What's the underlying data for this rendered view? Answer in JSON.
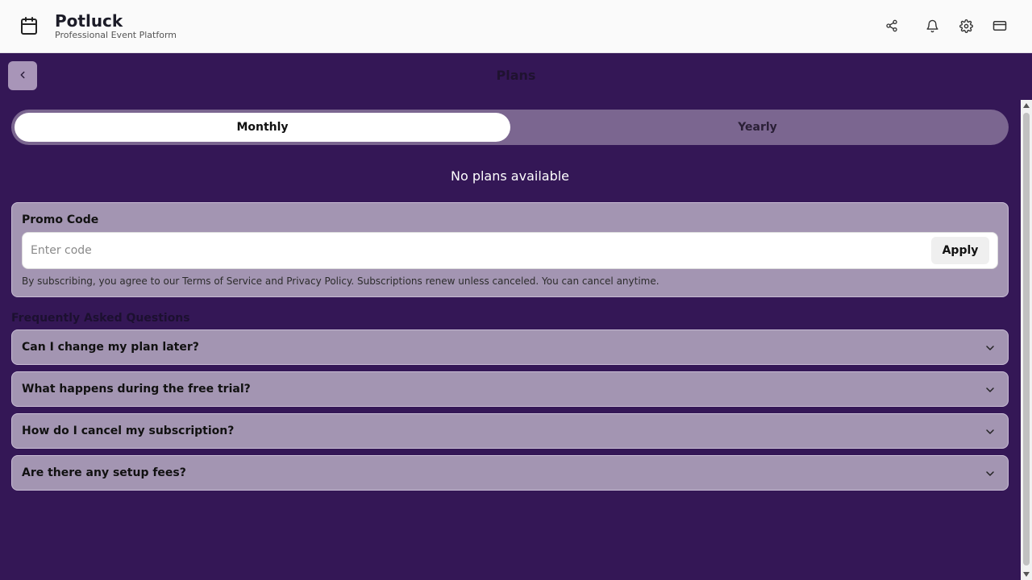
{
  "header": {
    "app_name": "Potluck",
    "app_subtitle": "Professional Event Platform",
    "logo_icon": "calendar-icon",
    "icons": [
      "share-icon",
      "bell-icon",
      "gear-icon",
      "credit-card-icon"
    ]
  },
  "page": {
    "title": "Plans",
    "back_icon": "chevron-left-icon"
  },
  "billing_toggle": {
    "options": [
      "Monthly",
      "Yearly"
    ],
    "selected": "Monthly"
  },
  "plans": {
    "empty_message": "No plans available"
  },
  "promo": {
    "title": "Promo Code",
    "placeholder": "Enter code",
    "value": "",
    "apply_label": "Apply",
    "terms": "By subscribing, you agree to our Terms of Service and Privacy Policy. Subscriptions renew unless canceled. You can cancel anytime."
  },
  "faq": {
    "heading": "Frequently Asked Questions",
    "items": [
      {
        "question": "Can I change my plan later?"
      },
      {
        "question": "What happens during the free trial?"
      },
      {
        "question": "How do I cancel my subscription?"
      },
      {
        "question": "Are there any setup fees?"
      }
    ]
  },
  "colors": {
    "page_background": "#341756",
    "header_background": "#fafafa",
    "card_background": "#a395b2",
    "toggle_track": "#7b6690",
    "toggle_active": "#ffffff"
  }
}
